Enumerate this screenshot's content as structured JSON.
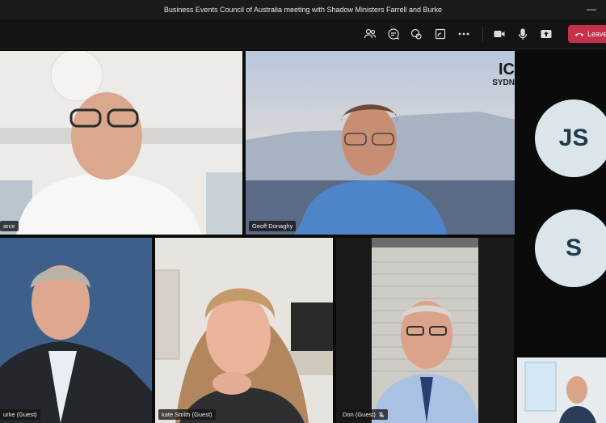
{
  "window": {
    "title": "Business Events Council of Australia meeting with Shadow Ministers Farrell and Burke"
  },
  "toolbar": {
    "icons": [
      "people-icon",
      "chat-icon",
      "reactions-icon",
      "share-tray-icon",
      "more-icon",
      "camera-icon",
      "mic-icon",
      "share-icon"
    ],
    "leave_label": "Leave",
    "leave_color": "#c4314b"
  },
  "participants": [
    {
      "name": "arce",
      "muted": false
    },
    {
      "name": "Geoff Donaghy",
      "muted": false
    },
    {
      "name": "urke (Guest)",
      "muted": false
    },
    {
      "name": "kate Smith (Guest)",
      "muted": false
    },
    {
      "name": "Don (Guest)",
      "muted": true
    }
  ],
  "background_logo": {
    "text_top": "IC",
    "text_bottom": "SYDN"
  },
  "avatars": [
    {
      "initials": "JS"
    },
    {
      "initials": "S"
    }
  ]
}
